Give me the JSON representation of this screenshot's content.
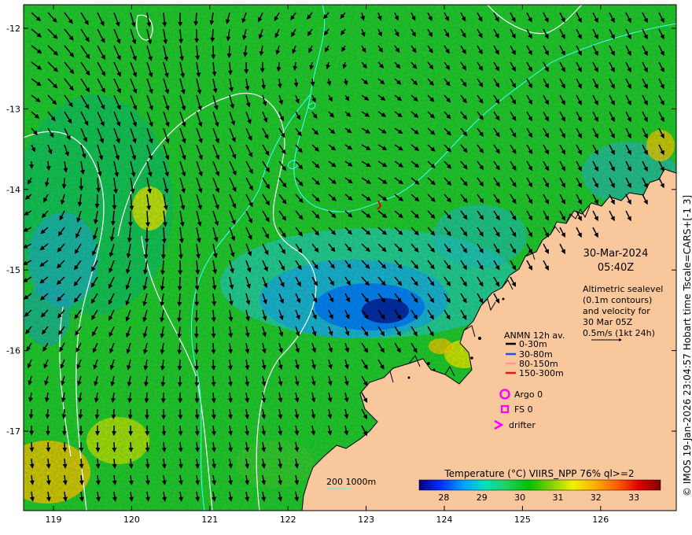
{
  "map": {
    "date": "30-Mar-2024",
    "time": "05:40Z",
    "description_lines": [
      "Altimetric sealevel",
      "(0.1m contours)",
      "and velocity for",
      "30 Mar 05Z",
      "0.5m/s (1kt 24h)"
    ],
    "credit": "© IMOS 19-Jan-2026 23:04:57 Hobart time Tscale=CARS+[-1 3]",
    "bathymetry_label": "200  1000m",
    "lon_ticks": [
      "119",
      "120",
      "121",
      "122",
      "123",
      "124",
      "125",
      "126"
    ],
    "lat_ticks": [
      "-12",
      "-13",
      "-14",
      "-15",
      "-16",
      "-17"
    ],
    "legend": {
      "title": "ANMN 12h av.",
      "items": [
        {
          "label": "0-30m",
          "color": "#000000"
        },
        {
          "label": "30-80m",
          "color": "#1e50ff"
        },
        {
          "label": "80-150m",
          "color": "#ff9999"
        },
        {
          "label": "150-300m",
          "color": "#ee1111"
        }
      ],
      "argo": "Argo 0",
      "fs": "FS 0",
      "drifter": "drifter",
      "marker_color": "#ff00ff"
    },
    "colorbar": {
      "title": "Temperature (°C) VIIRS_NPP 76% ql>=2",
      "ticks": [
        "28",
        "29",
        "30",
        "31",
        "32",
        "33"
      ],
      "colors": [
        "#000080",
        "#0030ff",
        "#00a0ff",
        "#00e0c0",
        "#20d060",
        "#00c000",
        "#80d000",
        "#f0f000",
        "#ffb000",
        "#ff6000",
        "#e00000",
        "#800000"
      ]
    },
    "colors": {
      "land": "#f8c89c",
      "ocean_base": "#22c22e",
      "cold_patch": "#00a8ff",
      "warm_patch": "#e8e000",
      "coast": "#000000",
      "contour_white": "#ffffff",
      "contour_cyan": "#40ffff"
    }
  }
}
